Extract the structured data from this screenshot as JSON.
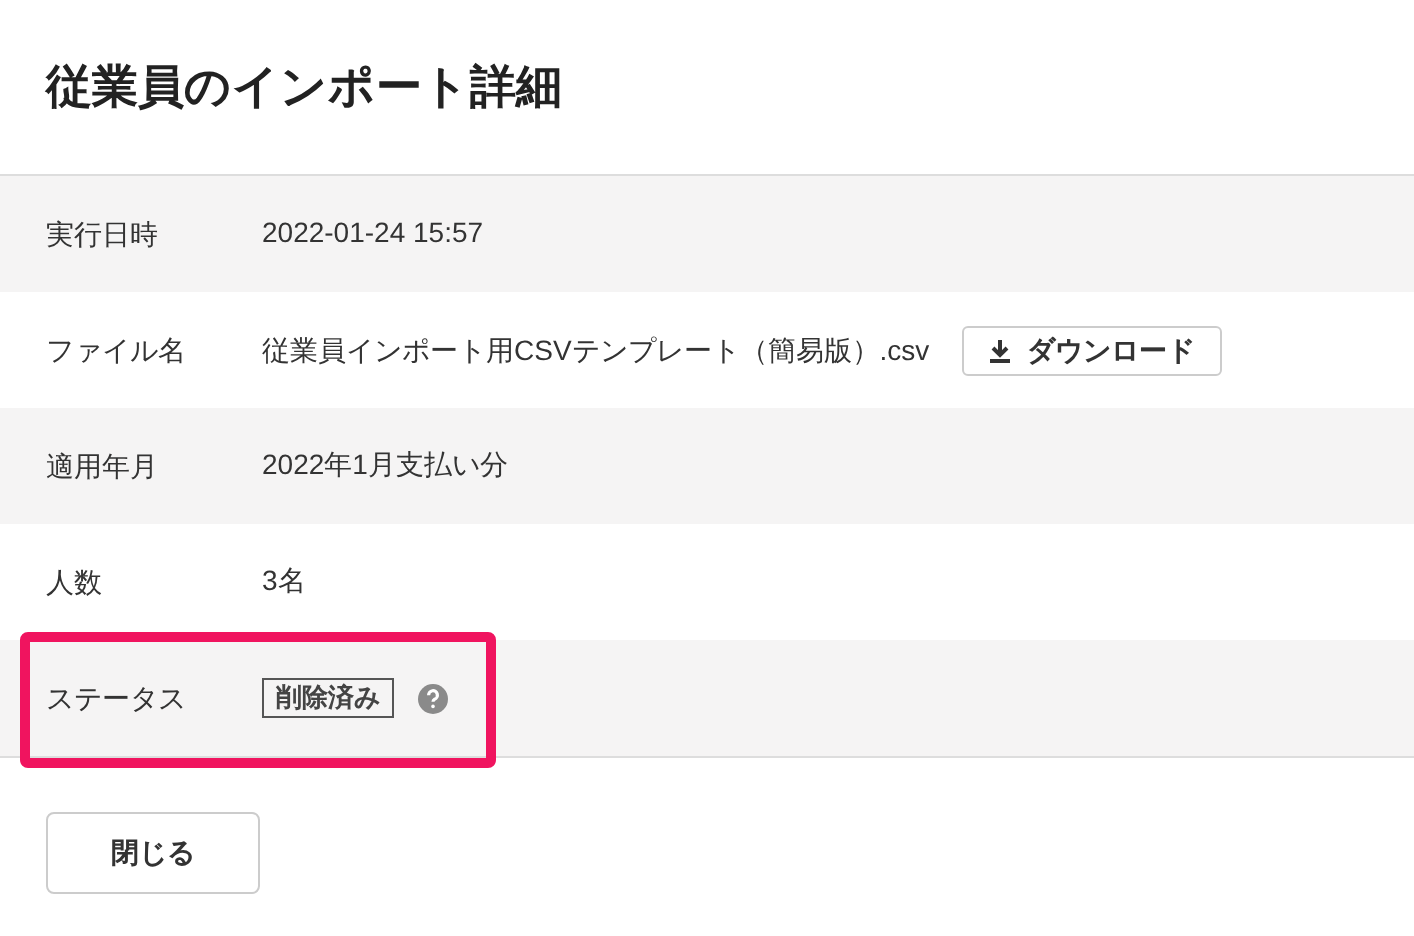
{
  "title": "従業員のインポート詳細",
  "rows": [
    {
      "kind": "text",
      "label": "実行日時",
      "value": "2022-01-24 15:57"
    },
    {
      "kind": "file",
      "label": "ファイル名",
      "value": "従業員インポート用CSVテンプレート（簡易版）.csv",
      "button": "ダウンロード"
    },
    {
      "kind": "text",
      "label": "適用年月",
      "value": "2022年1月支払い分"
    },
    {
      "kind": "text",
      "label": "人数",
      "value": "3名"
    },
    {
      "kind": "badge",
      "label": "ステータス",
      "value": "削除済み",
      "highlighted": true
    }
  ],
  "close_button": "閉じる"
}
